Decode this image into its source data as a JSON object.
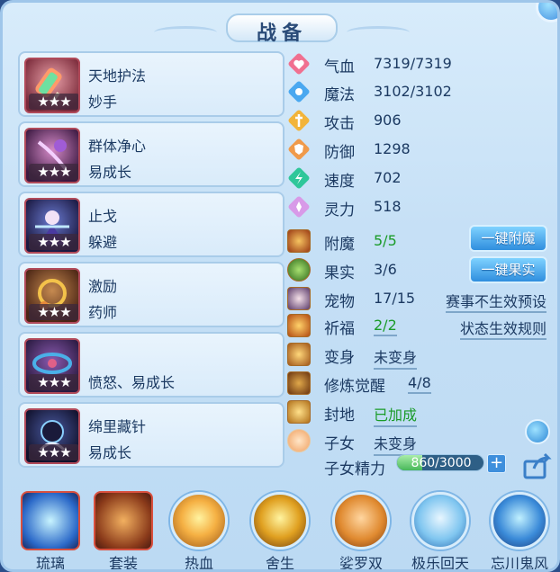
{
  "title": "战备",
  "skills": [
    {
      "name": "天地护法",
      "tag": "妙手",
      "stars": "★★★"
    },
    {
      "name": "群体净心",
      "tag": "易成长",
      "stars": "★★★"
    },
    {
      "name": "止戈",
      "tag": "躲避",
      "stars": "★★★"
    },
    {
      "name": "激励",
      "tag": "药师",
      "stars": "★★★"
    },
    {
      "name": "",
      "tag": "愤怒、易成长",
      "stars": "★★★"
    },
    {
      "name": "绵里藏针",
      "tag": "易成长",
      "stars": "★★★"
    }
  ],
  "stats": [
    {
      "label": "气血",
      "value": "7319/7319",
      "icon": "heart-icon",
      "color": "#f07090"
    },
    {
      "label": "魔法",
      "value": "3102/3102",
      "icon": "mana-icon",
      "color": "#4aa8f0"
    },
    {
      "label": "攻击",
      "value": "906",
      "icon": "sword-icon",
      "color": "#f2b43a"
    },
    {
      "label": "防御",
      "value": "1298",
      "icon": "shield-icon",
      "color": "#f09a4a"
    },
    {
      "label": "速度",
      "value": "702",
      "icon": "speed-icon",
      "color": "#2fc79a"
    },
    {
      "label": "灵力",
      "value": "518",
      "icon": "spirit-icon",
      "color": "#d89ae8"
    }
  ],
  "bonuses": {
    "fumo": {
      "label": "附魔",
      "value": "5/5"
    },
    "guoshi": {
      "label": "果实",
      "value": "3/6"
    },
    "chongwu": {
      "label": "宠物",
      "value": "17/15"
    },
    "qifu": {
      "label": "祈福",
      "value": "2/2"
    },
    "bianshen": {
      "label": "变身",
      "value": "未变身"
    },
    "xiulian": {
      "label": "修炼觉醒",
      "value": "4/8"
    },
    "fengdi": {
      "label": "封地",
      "value": "已加成"
    },
    "zinv": {
      "label": "子女",
      "value": "未变身"
    }
  },
  "buttons": {
    "one_click_enchant": "一键附魔",
    "one_click_fruit": "一键果实"
  },
  "links": {
    "match_preset": "赛事不生效预设",
    "status_rules": "状态生效规则"
  },
  "energy": {
    "label": "子女精力",
    "text": "860/3000",
    "fraction": 0.2867,
    "plus": "+"
  },
  "slots": [
    {
      "label": "琉璃"
    },
    {
      "label": "套装"
    },
    {
      "label": "热血"
    },
    {
      "label": "舍生"
    },
    {
      "label": "娑罗双"
    },
    {
      "label": "极乐回天"
    },
    {
      "label": "忘川鬼风"
    }
  ]
}
